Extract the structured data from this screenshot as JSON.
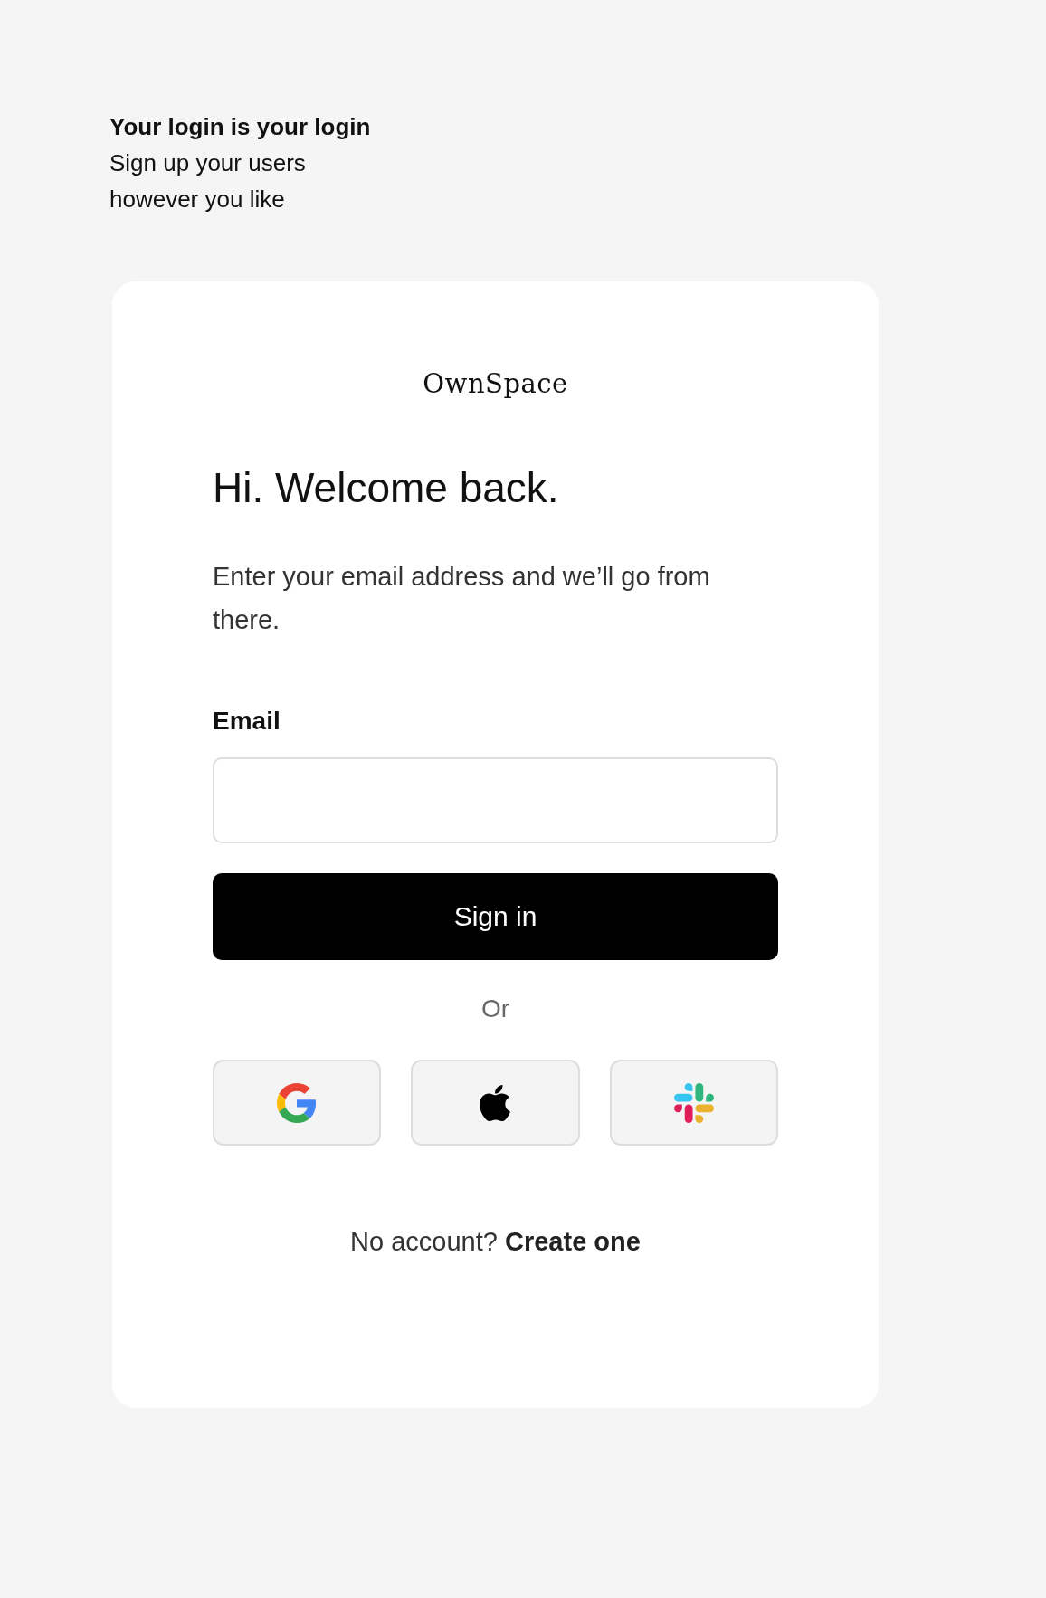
{
  "intro": {
    "title": "Your login is your login",
    "lines": [
      "Sign up your users",
      "however you like"
    ]
  },
  "card": {
    "logo": "OwnSpace",
    "heading": "Hi. Welcome back.",
    "description": "Enter your email address and we’ll go from there.",
    "email": {
      "label": "Email"
    },
    "submit": "Sign in",
    "divider": "Or",
    "providers": [
      {
        "kind": "google"
      },
      {
        "kind": "apple"
      },
      {
        "kind": "slack"
      }
    ],
    "footer": {
      "text": "No account?",
      "link": "Create one"
    }
  }
}
